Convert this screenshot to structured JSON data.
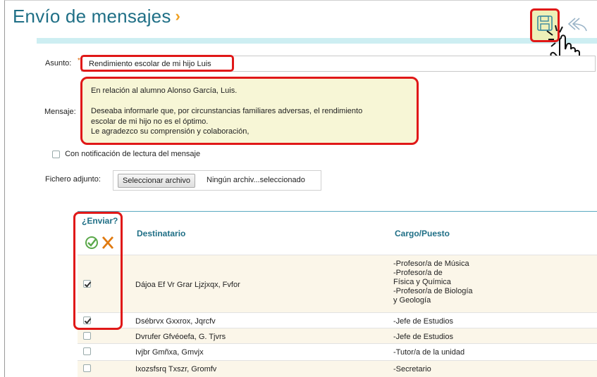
{
  "header": {
    "title": "Envío de mensajes",
    "title_arrow": "›"
  },
  "toolbar": {
    "save_icon": "floppy-disk-icon",
    "back_icon": "reply-icon"
  },
  "form": {
    "subject_label": "Asunto:",
    "subject_required_mark": "*",
    "subject_value": "Rendimiento escolar de mi hijo Luis",
    "message_label": "Mensaje:",
    "message_value": "En relación al alumno Alonso García, Luis.\n\nDeseaba informarle que, por circunstancias familiares adversas, el rendimiento\nescolar de mi hijo no es el óptimo.\nLe agradezco su comprensión y colaboración,",
    "read_receipt_label": "Con notificación de lectura del mensaje",
    "read_receipt_checked": false,
    "file_label": "Fichero adjunto:",
    "file_button": "Seleccionar archivo",
    "file_status": "Ningún archiv...seleccionado"
  },
  "table": {
    "headers": {
      "send": "¿Enviar?",
      "recipient": "Destinatario",
      "position": "Cargo/Puesto"
    },
    "rows": [
      {
        "checked": true,
        "recipient": "Dájoa Ef Vr Grar Ljzjxqx, Fvfor",
        "position": "-Profesor/a de Música\n-Profesor/a de\nFísica y Química\n-Profesor/a de Biología\ny Geología"
      },
      {
        "checked": true,
        "recipient": "Dsébrvx Gxxrox, Jqrcfv",
        "position": "-Jefe de Estudios"
      },
      {
        "checked": false,
        "recipient": "Dvrufer Gfvéoefa, G. Tjvrs",
        "position": "-Jefe de Estudios"
      },
      {
        "checked": false,
        "recipient": "Ivjbr Gmñxa, Gmvjx",
        "position": "-Tutor/a de la unidad"
      },
      {
        "checked": false,
        "recipient": "Ixozsfsrq Txszr, Gromfv",
        "position": "-Secretario"
      }
    ]
  },
  "colors": {
    "title": "#1f6f86",
    "highlight": "#e01818",
    "accent_arrow": "#f0a020",
    "check_all": "#5aa84a",
    "uncheck_all": "#e07a10"
  }
}
